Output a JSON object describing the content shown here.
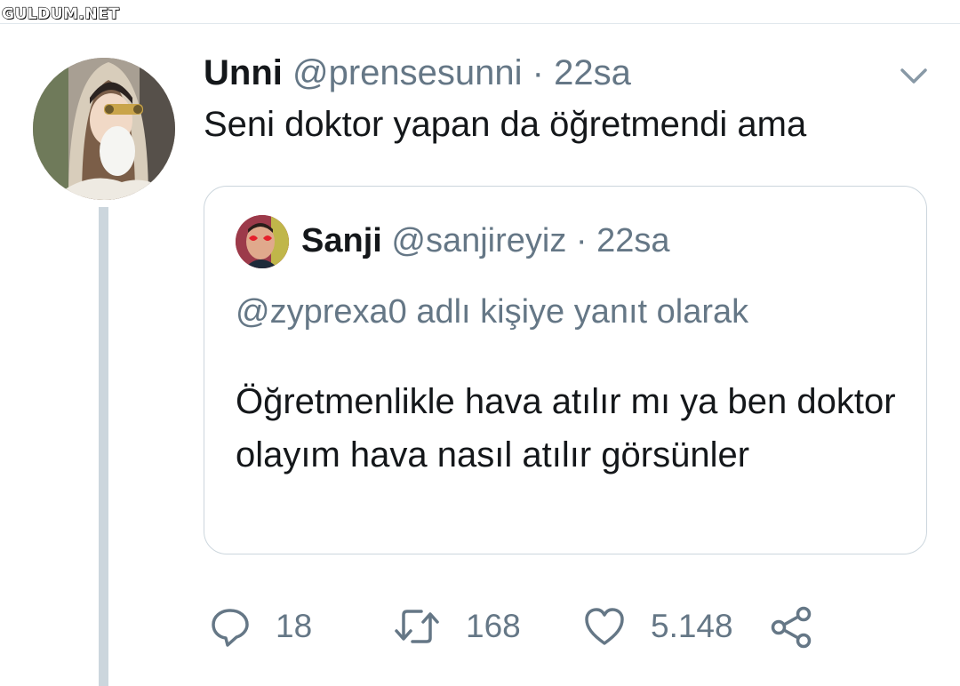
{
  "watermark": "GULDUM.NET",
  "tweet": {
    "name": "Unni",
    "handle": "@prensesunni",
    "separator": "·",
    "time": "22sa",
    "text": "Seni doktor yapan da öğretmendi ama"
  },
  "quote": {
    "name": "Sanji",
    "handle": "@sanjireyiz",
    "separator": "·",
    "time": "22sa",
    "reply_to": "@zyprexa0 adlı kişiye yanıt olarak",
    "text": "Öğretmenlikle hava atılır mı ya ben doktor olayım hava nasıl atılır görsünler"
  },
  "actions": {
    "replies": "18",
    "retweets": "168",
    "likes": "5.148"
  },
  "icons": [
    "chevron-down-icon",
    "reply-icon",
    "retweet-icon",
    "like-icon",
    "share-icon"
  ],
  "colors": {
    "text": "#14171a",
    "secondary": "#657786",
    "border": "#ccd6dd"
  }
}
